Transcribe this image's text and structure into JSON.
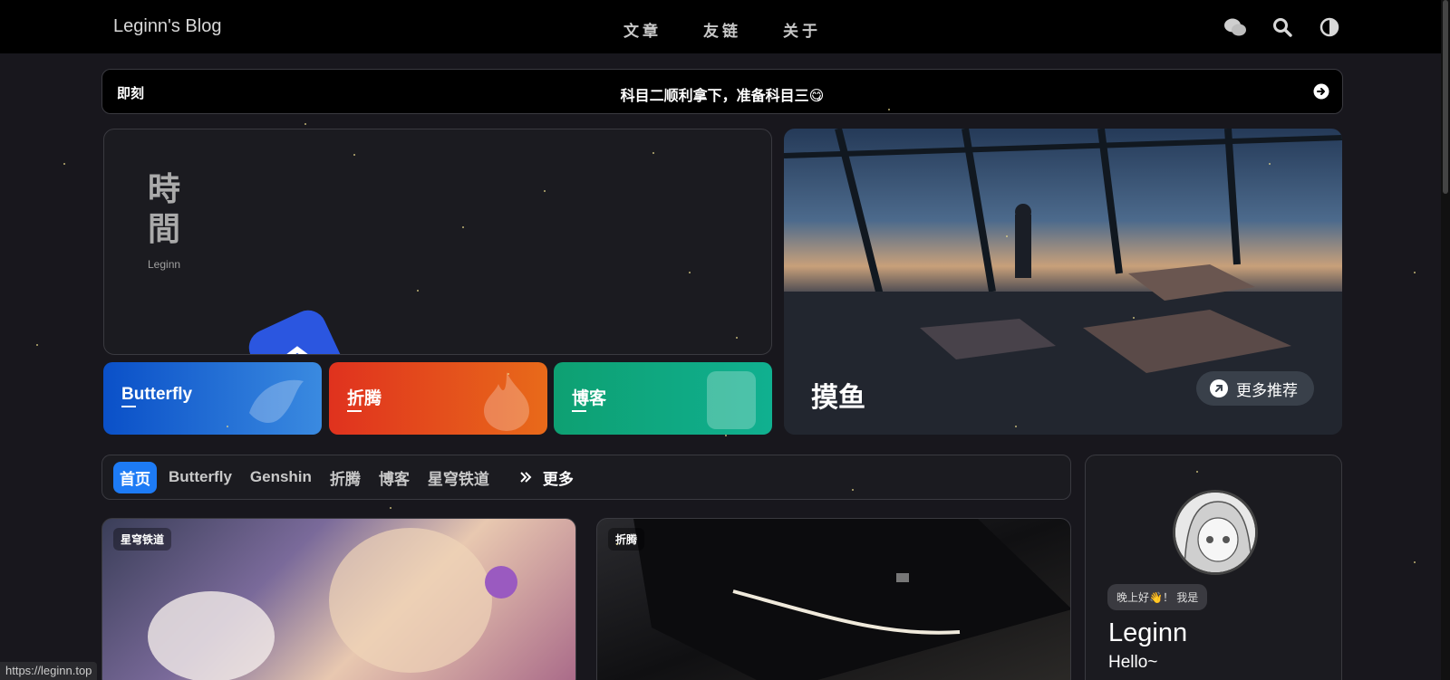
{
  "nav": {
    "brand": "Leginn's Blog",
    "menu": [
      "文章",
      "友链",
      "关于"
    ],
    "icons": [
      "wechat-icon",
      "search-icon",
      "dark-mode-icon"
    ]
  },
  "ticker": {
    "tag": "即刻",
    "text": "科目二顺利拿下，准备科目三😋"
  },
  "hero": {
    "title_line1": "時",
    "title_line2": "間",
    "subtitle": "Leginn"
  },
  "tiles": [
    {
      "label": "Butterfly",
      "icon": "bird-icon"
    },
    {
      "label": "折腾",
      "icon": "flame-icon"
    },
    {
      "label": "博客",
      "icon": "document-icon"
    }
  ],
  "feature": {
    "label": "摸鱼",
    "more_label": "更多推荐"
  },
  "categories": {
    "items": [
      "首页",
      "Butterfly",
      "Genshin",
      "折腾",
      "博客",
      "星穹铁道"
    ],
    "active": "首页",
    "more_label": "更多"
  },
  "posts": [
    {
      "tag": "星穹铁道"
    },
    {
      "tag": "折腾"
    }
  ],
  "profile": {
    "greeting": "晚上好👋！ 我是",
    "name": "Leginn",
    "hello": "Hello~"
  },
  "status_url": "https://leginn.top",
  "colors": {
    "accent": "#1d7bf5",
    "background": "#18171d",
    "card": "#1b1b20"
  }
}
